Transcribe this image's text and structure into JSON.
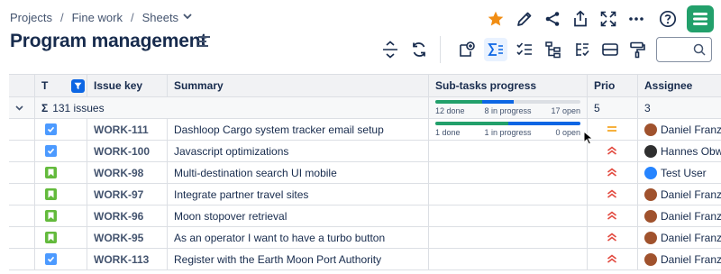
{
  "breadcrumb": {
    "projects": "Projects",
    "sep1": "/",
    "fine_work": "Fine work",
    "sep2": "/",
    "sheets": "Sheets"
  },
  "page": {
    "title": "Program management"
  },
  "colors": {
    "accent": "#0c66e4",
    "brand": "#22a06b",
    "star": "#f18d13",
    "done": "#22a06b",
    "in_progress": "#0c66e4",
    "open": "#dcdfe4",
    "prio_high": "#e2483d",
    "prio_medium": "#f5a623"
  },
  "toolbar": {
    "top_icons": [
      "star-icon",
      "edit-pencil-icon",
      "share-icon",
      "export-icon",
      "fullscreen-icon",
      "more-icon",
      "help-icon"
    ],
    "tools": [
      "collapse-expand-icon",
      "refresh-icon",
      "add-record-icon",
      "sum-icon",
      "checklist-icon",
      "hierarchy-icon",
      "sorted-list-icon",
      "card-view-icon",
      "format-paint-icon"
    ],
    "search_placeholder": ""
  },
  "table": {
    "columns": {
      "type": "T",
      "issue_key": "Issue key",
      "summary": "Summary",
      "subtasks": "Sub-tasks progress",
      "priority": "Prio",
      "assignee": "Assignee"
    },
    "group": {
      "sigma": "Σ",
      "count": "131 issues",
      "progress": {
        "done_label": "12 done",
        "in_progress_label": "8 in progress",
        "open_label": "17 open",
        "done": 12,
        "in_progress": 8,
        "open": 17
      },
      "prio_sum": "5",
      "assignee_sum": "3"
    },
    "rows": [
      {
        "type": "task",
        "key": "WORK-111",
        "summary": "Dashloop Cargo system tracker email setup",
        "progress": {
          "done_label": "1 done",
          "in_progress_label": "1 in progress",
          "open_label": "0 open",
          "done": 1,
          "in_progress": 1,
          "open": 0
        },
        "priority": "medium",
        "assignee": "Daniel Franz"
      },
      {
        "type": "task",
        "key": "WORK-100",
        "summary": "Javascript optimizations",
        "priority": "high",
        "assignee": "Hannes Obwe"
      },
      {
        "type": "story",
        "key": "WORK-98",
        "summary": "Multi-destination search UI mobile",
        "priority": "high",
        "assignee": "Test User"
      },
      {
        "type": "story",
        "key": "WORK-97",
        "summary": "Integrate partner travel sites",
        "priority": "high",
        "assignee": "Daniel Franz"
      },
      {
        "type": "story",
        "key": "WORK-96",
        "summary": "Moon stopover retrieval",
        "priority": "high",
        "assignee": "Daniel Franz"
      },
      {
        "type": "story",
        "key": "WORK-95",
        "summary": "As an operator I want to have a turbo button",
        "priority": "high",
        "assignee": "Daniel Franz"
      },
      {
        "type": "task",
        "key": "WORK-113",
        "summary": "Register with the Earth Moon Port Authority",
        "priority": "high",
        "assignee": "Daniel Franz"
      }
    ]
  }
}
